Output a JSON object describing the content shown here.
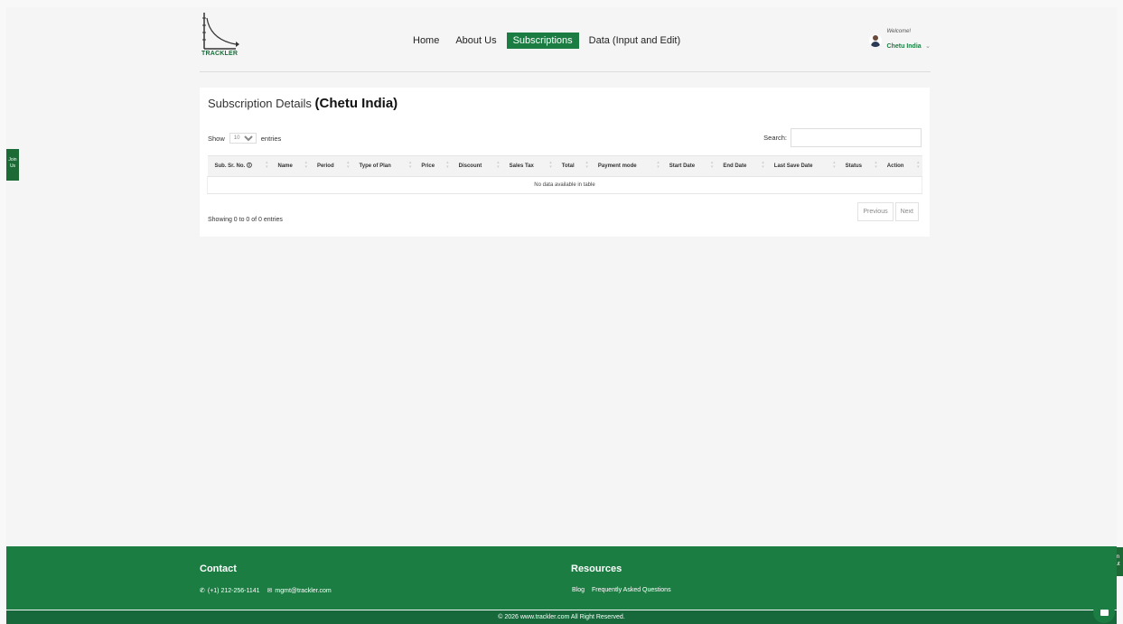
{
  "header": {
    "logo_text": "TRACKLER",
    "nav": [
      {
        "label": "Home"
      },
      {
        "label": "About Us"
      },
      {
        "label": "Subscriptions"
      },
      {
        "label": "Data (Input and Edit)"
      }
    ],
    "active_nav": "Subscriptions",
    "welcome": "Welcome!",
    "username": "Chetu India"
  },
  "card": {
    "title": "Subscription Details",
    "company": "(Chetu India)",
    "show_label": "Show",
    "entries_label": "entries",
    "page_length": "10",
    "search_label": "Search:",
    "search_value": "",
    "columns": [
      "Sub. Sr. No.",
      "Name",
      "Period",
      "Type of Plan",
      "Price",
      "Discount",
      "Sales Tax",
      "Total",
      "Payment mode",
      "Start Date",
      "End Date",
      "Last Save Date",
      "Status",
      "Action"
    ],
    "empty_message": "No data available in table",
    "info": "Showing 0 to 0 of 0 entries",
    "prev": "Previous",
    "next": "Next"
  },
  "side": {
    "join": "Join Us",
    "zoom": "Zoom In/Out"
  },
  "footer": {
    "contact_heading": "Contact",
    "phone": "(+1) 212-256-1141",
    "email": "mgmt@trackler.com",
    "resources_heading": "Resources",
    "resources": [
      "Blog",
      "Frequently Asked Questions"
    ],
    "copyright": "© 2026  www.trackler.com  All Right Reserved."
  },
  "colors": {
    "brand": "#1c7d43",
    "background": "#f5f5f5"
  }
}
